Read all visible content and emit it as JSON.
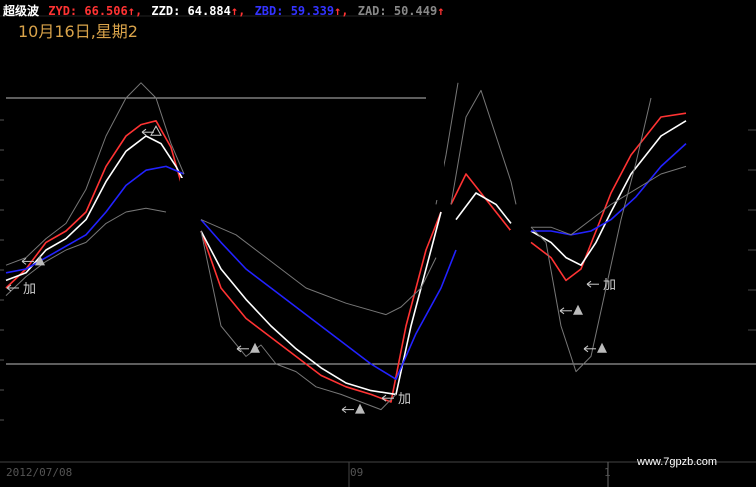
{
  "header": {
    "indicator_name": "超级波",
    "items": [
      {
        "label": "ZYD:",
        "value": "66.506",
        "arrow": "↑",
        "color": "#ff3333"
      },
      {
        "label": "ZZD:",
        "value": "64.884",
        "arrow": "↑",
        "color": "#ffffff"
      },
      {
        "label": "ZBD:",
        "value": "59.339",
        "arrow": "↑",
        "color": "#3333ff"
      },
      {
        "label": "ZAD:",
        "value": "50.449",
        "arrow": "↑",
        "color": "#888888"
      }
    ],
    "date_text": "10月16日,星期2"
  },
  "watermark": "www.7gpzb.com",
  "x_labels": [
    "2012/07/08",
    "09",
    "1"
  ],
  "chart_data": {
    "type": "line",
    "title": "超级波",
    "reference_lines": [
      {
        "label": "",
        "value": 90
      },
      {
        "label": "",
        "value": 20
      }
    ],
    "ylim": [
      0,
      100
    ],
    "series": [
      {
        "name": "ZYD",
        "color": "#ff3333",
        "segments": [
          [
            [
              0,
              40
            ],
            [
              20,
              45
            ],
            [
              40,
              52
            ],
            [
              60,
              55
            ],
            [
              80,
              60
            ],
            [
              100,
              72
            ],
            [
              120,
              80
            ],
            [
              135,
              83
            ],
            [
              150,
              84
            ],
            [
              165,
              77
            ],
            [
              178,
              65
            ]
          ],
          [
            [
              195,
              55
            ],
            [
              215,
              40
            ],
            [
              240,
              32
            ],
            [
              265,
              27
            ],
            [
              290,
              22
            ],
            [
              315,
              17
            ],
            [
              340,
              14
            ],
            [
              365,
              12
            ],
            [
              385,
              10
            ],
            [
              400,
              30
            ],
            [
              420,
              50
            ],
            [
              435,
              60
            ]
          ],
          [
            [
              445,
              62
            ],
            [
              460,
              70
            ],
            [
              475,
              65
            ],
            [
              490,
              60
            ],
            [
              505,
              55
            ]
          ],
          [
            [
              525,
              52
            ],
            [
              545,
              48
            ],
            [
              560,
              42
            ],
            [
              575,
              45
            ],
            [
              590,
              55
            ],
            [
              605,
              65
            ],
            [
              625,
              75
            ],
            [
              655,
              85
            ],
            [
              680,
              86
            ]
          ]
        ]
      },
      {
        "name": "ZZD",
        "color": "#ffffff",
        "segments": [
          [
            [
              0,
              42
            ],
            [
              20,
              44
            ],
            [
              40,
              50
            ],
            [
              60,
              53
            ],
            [
              80,
              58
            ],
            [
              100,
              68
            ],
            [
              120,
              76
            ],
            [
              140,
              80
            ],
            [
              155,
              78
            ],
            [
              170,
              72
            ],
            [
              178,
              68
            ]
          ],
          [
            [
              195,
              55
            ],
            [
              215,
              45
            ],
            [
              240,
              37
            ],
            [
              265,
              30
            ],
            [
              290,
              24
            ],
            [
              315,
              19
            ],
            [
              340,
              15
            ],
            [
              365,
              13
            ],
            [
              390,
              12
            ],
            [
              405,
              30
            ],
            [
              425,
              50
            ],
            [
              435,
              60
            ]
          ],
          [
            [
              450,
              58
            ],
            [
              470,
              65
            ],
            [
              490,
              62
            ],
            [
              505,
              57
            ]
          ],
          [
            [
              525,
              55
            ],
            [
              545,
              52
            ],
            [
              560,
              48
            ],
            [
              575,
              46
            ],
            [
              590,
              52
            ],
            [
              605,
              60
            ],
            [
              625,
              70
            ],
            [
              655,
              80
            ],
            [
              680,
              84
            ]
          ]
        ]
      },
      {
        "name": "ZBD",
        "color": "#2222ff",
        "segments": [
          [
            [
              0,
              44
            ],
            [
              20,
              45
            ],
            [
              40,
              48
            ],
            [
              60,
              51
            ],
            [
              80,
              54
            ],
            [
              100,
              60
            ],
            [
              120,
              67
            ],
            [
              140,
              71
            ],
            [
              160,
              72
            ],
            [
              178,
              70
            ]
          ],
          [
            [
              195,
              58
            ],
            [
              215,
              52
            ],
            [
              240,
              45
            ],
            [
              265,
              40
            ],
            [
              290,
              35
            ],
            [
              315,
              30
            ],
            [
              340,
              25
            ],
            [
              365,
              20
            ],
            [
              390,
              16
            ],
            [
              410,
              28
            ],
            [
              435,
              40
            ],
            [
              450,
              50
            ]
          ],
          [
            [
              525,
              55
            ],
            [
              545,
              55
            ],
            [
              565,
              54
            ],
            [
              585,
              55
            ],
            [
              605,
              58
            ],
            [
              630,
              64
            ],
            [
              655,
              72
            ],
            [
              680,
              78
            ]
          ]
        ]
      },
      {
        "name": "ZAD",
        "color": "#777777",
        "segments": [
          [
            [
              0,
              38
            ],
            [
              20,
              43
            ],
            [
              40,
              47
            ],
            [
              60,
              50
            ],
            [
              80,
              52
            ],
            [
              100,
              57
            ],
            [
              120,
              60
            ],
            [
              140,
              61
            ],
            [
              160,
              60
            ]
          ],
          [
            [
              0,
              46
            ],
            [
              20,
              48
            ],
            [
              40,
              53
            ],
            [
              60,
              57
            ],
            [
              80,
              66
            ],
            [
              100,
              80
            ],
            [
              120,
              90
            ],
            [
              135,
              94
            ],
            [
              150,
              90
            ],
            [
              165,
              78
            ],
            [
              178,
              70
            ]
          ],
          [
            [
              195,
              55
            ],
            [
              215,
              30
            ],
            [
              240,
              22
            ],
            [
              255,
              25
            ],
            [
              270,
              20
            ],
            [
              290,
              18
            ],
            [
              310,
              14
            ],
            [
              335,
              12
            ],
            [
              355,
              10
            ],
            [
              375,
              8
            ],
            [
              390,
              12
            ]
          ],
          [
            [
              195,
              58
            ],
            [
              230,
              54
            ],
            [
              265,
              47
            ],
            [
              300,
              40
            ],
            [
              340,
              36
            ],
            [
              380,
              33
            ],
            [
              395,
              35
            ],
            [
              415,
              40
            ],
            [
              430,
              48
            ]
          ],
          [
            [
              445,
              62
            ],
            [
              460,
              85
            ],
            [
              475,
              92
            ],
            [
              490,
              80
            ],
            [
              505,
              68
            ],
            [
              510,
              62
            ]
          ],
          [
            [
              430,
              62
            ],
            [
              440,
              75
            ],
            [
              452,
              94
            ]
          ],
          [
            [
              525,
              56
            ],
            [
              540,
              52
            ],
            [
              555,
              30
            ],
            [
              570,
              18
            ],
            [
              585,
              22
            ],
            [
              600,
              40
            ],
            [
              615,
              58
            ],
            [
              630,
              73
            ],
            [
              645,
              90
            ]
          ],
          [
            [
              525,
              56
            ],
            [
              545,
              56
            ],
            [
              565,
              54
            ],
            [
              585,
              58
            ],
            [
              605,
              62
            ],
            [
              630,
              66
            ],
            [
              655,
              70
            ],
            [
              680,
              72
            ]
          ]
        ]
      }
    ],
    "signals": [
      {
        "text": "加",
        "x": 15,
        "y": 40
      },
      {
        "text": "",
        "x": 30,
        "y": 47
      },
      {
        "text": "△",
        "x": 150,
        "y": 81
      },
      {
        "text": "",
        "x": 245,
        "y": 24
      },
      {
        "text": "",
        "x": 350,
        "y": 8
      },
      {
        "text": "加",
        "x": 390,
        "y": 11
      },
      {
        "text": "",
        "x": 568,
        "y": 34
      },
      {
        "text": "",
        "x": 592,
        "y": 24
      },
      {
        "text": "加",
        "x": 595,
        "y": 41
      }
    ]
  }
}
